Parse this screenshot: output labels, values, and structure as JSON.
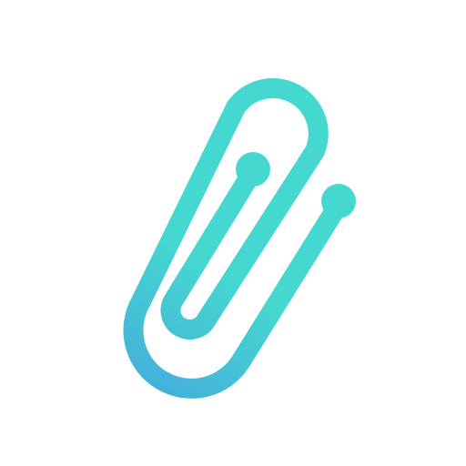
{
  "icon": {
    "name": "paperclip-icon",
    "colors": {
      "background": "#ffffff",
      "primary": "#45d8d0",
      "gradient_end": "#45afdb"
    }
  }
}
